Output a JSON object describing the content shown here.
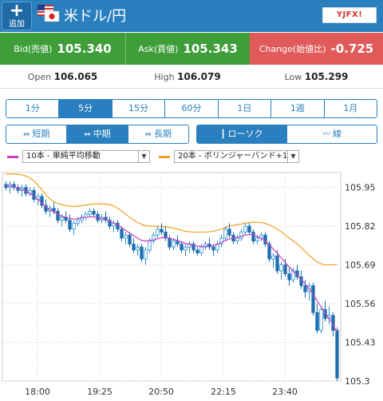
{
  "header": {
    "add_label": "追加",
    "add_icon": "plus-icon",
    "pair_title": "米ドル/円",
    "brand_label": "YJFX!",
    "colors": {
      "bar": "#2a7fbe"
    }
  },
  "rates": {
    "bid_label": "Bid(売値)",
    "bid_value": "105.340",
    "ask_label": "Ask(買値)",
    "ask_value": "105.343",
    "change_label": "Change(始値比)",
    "change_value": "-0.725"
  },
  "stats": {
    "open_label": "Open",
    "open_value": "106.065",
    "high_label": "High",
    "high_value": "106.079",
    "low_label": "Low",
    "low_value": "105.299"
  },
  "periods": [
    "1分",
    "5分",
    "15分",
    "60分",
    "1日",
    "1週",
    "1月"
  ],
  "active_period": "5分",
  "ranges": [
    "短期",
    "中期",
    "長期"
  ],
  "active_range": "中期",
  "chart_types": [
    "ローソク",
    "線"
  ],
  "active_chart_type": "ローソク",
  "indicators": [
    {
      "label": "10本 - 単純平均移動",
      "color": "#c83ec0"
    },
    {
      "label": "20本 - ボリンジャーバンド+1",
      "color": "#f0a020"
    }
  ],
  "chart_data": {
    "type": "candlestick",
    "x_labels": [
      "18:00",
      "19:25",
      "20:50",
      "22:15",
      "23:40"
    ],
    "y_ticks": [
      "105.95",
      "105.82",
      "105.69",
      "105.56",
      "105.43",
      "105.3"
    ],
    "y_range": [
      105.3,
      106.0
    ],
    "colors": {
      "up": "#2a8fd0",
      "down": "#1f6fb0",
      "sma": "#c83ec0",
      "band": "#f0a020"
    },
    "candles": [
      [
        105.96,
        105.97,
        105.94,
        105.95
      ],
      [
        105.95,
        105.97,
        105.93,
        105.96
      ],
      [
        105.96,
        105.97,
        105.94,
        105.95
      ],
      [
        105.95,
        105.96,
        105.93,
        105.94
      ],
      [
        105.94,
        105.96,
        105.92,
        105.95
      ],
      [
        105.95,
        105.96,
        105.92,
        105.93
      ],
      [
        105.93,
        105.95,
        105.92,
        105.94
      ],
      [
        105.94,
        105.95,
        105.9,
        105.91
      ],
      [
        105.91,
        105.93,
        105.89,
        105.92
      ],
      [
        105.92,
        105.93,
        105.88,
        105.89
      ],
      [
        105.89,
        105.91,
        105.86,
        105.87
      ],
      [
        105.87,
        105.89,
        105.85,
        105.88
      ],
      [
        105.88,
        105.9,
        105.86,
        105.87
      ],
      [
        105.87,
        105.88,
        105.83,
        105.84
      ],
      [
        105.84,
        105.86,
        105.82,
        105.85
      ],
      [
        105.85,
        105.87,
        105.83,
        105.84
      ],
      [
        105.84,
        105.86,
        105.8,
        105.81
      ],
      [
        105.81,
        105.84,
        105.79,
        105.83
      ],
      [
        105.83,
        105.85,
        105.82,
        105.84
      ],
      [
        105.84,
        105.86,
        105.83,
        105.85
      ],
      [
        105.85,
        105.87,
        105.84,
        105.86
      ],
      [
        105.86,
        105.88,
        105.85,
        105.87
      ],
      [
        105.87,
        105.88,
        105.85,
        105.86
      ],
      [
        105.86,
        105.87,
        105.83,
        105.84
      ],
      [
        105.84,
        105.86,
        105.83,
        105.85
      ],
      [
        105.85,
        105.87,
        105.83,
        105.84
      ],
      [
        105.84,
        105.85,
        105.81,
        105.82
      ],
      [
        105.82,
        105.84,
        105.8,
        105.83
      ],
      [
        105.83,
        105.84,
        105.8,
        105.81
      ],
      [
        105.81,
        105.82,
        105.77,
        105.78
      ],
      [
        105.78,
        105.8,
        105.76,
        105.79
      ],
      [
        105.79,
        105.8,
        105.75,
        105.76
      ],
      [
        105.76,
        105.78,
        105.73,
        105.74
      ],
      [
        105.74,
        105.76,
        105.72,
        105.75
      ],
      [
        105.75,
        105.76,
        105.7,
        105.71
      ],
      [
        105.71,
        105.75,
        105.69,
        105.74
      ],
      [
        105.74,
        105.78,
        105.73,
        105.77
      ],
      [
        105.77,
        105.8,
        105.76,
        105.79
      ],
      [
        105.79,
        105.82,
        105.78,
        105.81
      ],
      [
        105.81,
        105.83,
        105.79,
        105.8
      ],
      [
        105.8,
        105.82,
        105.77,
        105.78
      ],
      [
        105.78,
        105.79,
        105.74,
        105.75
      ],
      [
        105.75,
        105.78,
        105.74,
        105.77
      ],
      [
        105.77,
        105.79,
        105.75,
        105.76
      ],
      [
        105.76,
        105.77,
        105.73,
        105.74
      ],
      [
        105.74,
        105.76,
        105.72,
        105.75
      ],
      [
        105.75,
        105.77,
        105.73,
        105.76
      ],
      [
        105.76,
        105.77,
        105.73,
        105.74
      ],
      [
        105.74,
        105.75,
        105.72,
        105.73
      ],
      [
        105.73,
        105.76,
        105.72,
        105.75
      ],
      [
        105.75,
        105.77,
        105.74,
        105.76
      ],
      [
        105.76,
        105.78,
        105.74,
        105.75
      ],
      [
        105.75,
        105.76,
        105.72,
        105.74
      ],
      [
        105.74,
        105.77,
        105.73,
        105.76
      ],
      [
        105.76,
        105.79,
        105.75,
        105.78
      ],
      [
        105.78,
        105.82,
        105.77,
        105.81
      ],
      [
        105.81,
        105.83,
        105.78,
        105.79
      ],
      [
        105.79,
        105.8,
        105.76,
        105.77
      ],
      [
        105.77,
        105.79,
        105.76,
        105.78
      ],
      [
        105.78,
        105.81,
        105.77,
        105.8
      ],
      [
        105.8,
        105.83,
        105.79,
        105.82
      ],
      [
        105.82,
        105.83,
        105.79,
        105.8
      ],
      [
        105.8,
        105.81,
        105.76,
        105.77
      ],
      [
        105.77,
        105.79,
        105.76,
        105.78
      ],
      [
        105.78,
        105.8,
        105.77,
        105.79
      ],
      [
        105.79,
        105.8,
        105.75,
        105.76
      ],
      [
        105.76,
        105.77,
        105.7,
        105.71
      ],
      [
        105.71,
        105.73,
        105.68,
        105.72
      ],
      [
        105.72,
        105.74,
        105.66,
        105.67
      ],
      [
        105.67,
        105.7,
        105.64,
        105.69
      ],
      [
        105.69,
        105.71,
        105.65,
        105.66
      ],
      [
        105.66,
        105.68,
        105.62,
        105.64
      ],
      [
        105.64,
        105.68,
        105.63,
        105.67
      ],
      [
        105.67,
        105.69,
        105.64,
        105.65
      ],
      [
        105.65,
        105.67,
        105.61,
        105.62
      ],
      [
        105.62,
        105.64,
        105.58,
        105.6
      ],
      [
        105.6,
        105.63,
        105.57,
        105.62
      ],
      [
        105.62,
        105.63,
        105.52,
        105.53
      ],
      [
        105.53,
        105.56,
        105.46,
        105.47
      ],
      [
        105.47,
        105.55,
        105.46,
        105.54
      ],
      [
        105.54,
        105.57,
        105.5,
        105.51
      ],
      [
        105.51,
        105.55,
        105.49,
        105.52
      ],
      [
        105.52,
        105.53,
        105.45,
        105.47
      ],
      [
        105.47,
        105.48,
        105.3,
        105.31
      ]
    ],
    "sma": [
      105.955,
      105.955,
      105.952,
      105.948,
      105.944,
      105.938,
      105.93,
      105.92,
      105.91,
      105.898,
      105.885,
      105.875,
      105.868,
      105.86,
      105.853,
      105.85,
      105.846,
      105.844,
      105.845,
      105.848,
      105.85,
      105.851,
      105.851,
      105.849,
      105.846,
      105.842,
      105.836,
      105.83,
      105.823,
      105.815,
      105.806,
      105.797,
      105.788,
      105.78,
      105.772,
      105.77,
      105.771,
      105.774,
      105.778,
      105.781,
      105.782,
      105.779,
      105.776,
      105.772,
      105.767,
      105.762,
      105.759,
      105.756,
      105.753,
      105.752,
      105.752,
      105.753,
      105.755,
      105.759,
      105.765,
      105.772,
      105.777,
      105.78,
      105.782,
      105.786,
      105.79,
      105.792,
      105.79,
      105.785,
      105.779,
      105.77,
      105.757,
      105.743,
      105.729,
      105.714,
      105.698,
      105.683,
      105.668,
      105.654,
      105.641,
      105.626,
      105.61,
      105.591,
      105.569,
      105.549,
      105.53,
      105.51,
      105.489,
      105.462
    ],
    "band": [
      105.995,
      105.995,
      105.995,
      105.994,
      105.992,
      105.988,
      105.982,
      105.972,
      105.958,
      105.942,
      105.925,
      105.912,
      105.902,
      105.896,
      105.892,
      105.889,
      105.887,
      105.886,
      105.887,
      105.889,
      105.891,
      105.893,
      105.894,
      105.895,
      105.895,
      105.894,
      105.892,
      105.888,
      105.88,
      105.871,
      105.86,
      105.85,
      105.841,
      105.832,
      105.826,
      105.822,
      105.82,
      105.82,
      105.82,
      105.819,
      105.818,
      105.816,
      105.813,
      105.81,
      105.806,
      105.803,
      105.801,
      105.8,
      105.8,
      105.8,
      105.8,
      105.801,
      105.803,
      105.806,
      105.81,
      105.815,
      105.82,
      105.823,
      105.825,
      105.827,
      105.83,
      105.832,
      105.833,
      105.833,
      105.832,
      105.829,
      105.824,
      105.818,
      105.81,
      105.801,
      105.79,
      105.78,
      105.77,
      105.76,
      105.748,
      105.735,
      105.722,
      105.71,
      105.7,
      105.693,
      105.69,
      105.69,
      105.69,
      105.691
    ]
  }
}
